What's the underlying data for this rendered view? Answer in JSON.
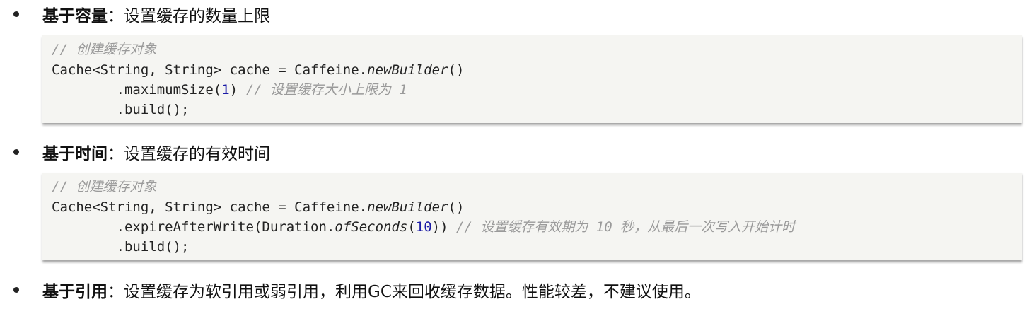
{
  "items": [
    {
      "title": "基于容量",
      "desc": "：设置缓存的数量上限"
    },
    {
      "title": "基于时间",
      "desc": "：设置缓存的有效时间"
    },
    {
      "title": "基于引用",
      "desc": "：设置缓存为软引用或弱引用，利用GC来回收缓存数据。性能较差，不建议使用。"
    }
  ],
  "code1": {
    "comment": "// 创建缓存对象",
    "line2_a": "Cache<String, String> cache = Caffeine.",
    "line2_b": "newBuilder",
    "line2_c": "()",
    "line3_a": "        .maximumSize(",
    "line3_num": "1",
    "line3_b": ") ",
    "line3_comment": "// 设置缓存大小上限为 1",
    "line4": "        .build();"
  },
  "code2": {
    "comment": "// 创建缓存对象",
    "line2_a": "Cache<String, String> cache = Caffeine.",
    "line2_b": "newBuilder",
    "line2_c": "()",
    "line3_a": "        .expireAfterWrite(Duration.",
    "line3_italic": "ofSeconds",
    "line3_b": "(",
    "line3_num": "10",
    "line3_c": ")) ",
    "line3_comment": "// 设置缓存有效期为 10 秒，从最后一次写入开始计时",
    "line4": "        .build();"
  }
}
